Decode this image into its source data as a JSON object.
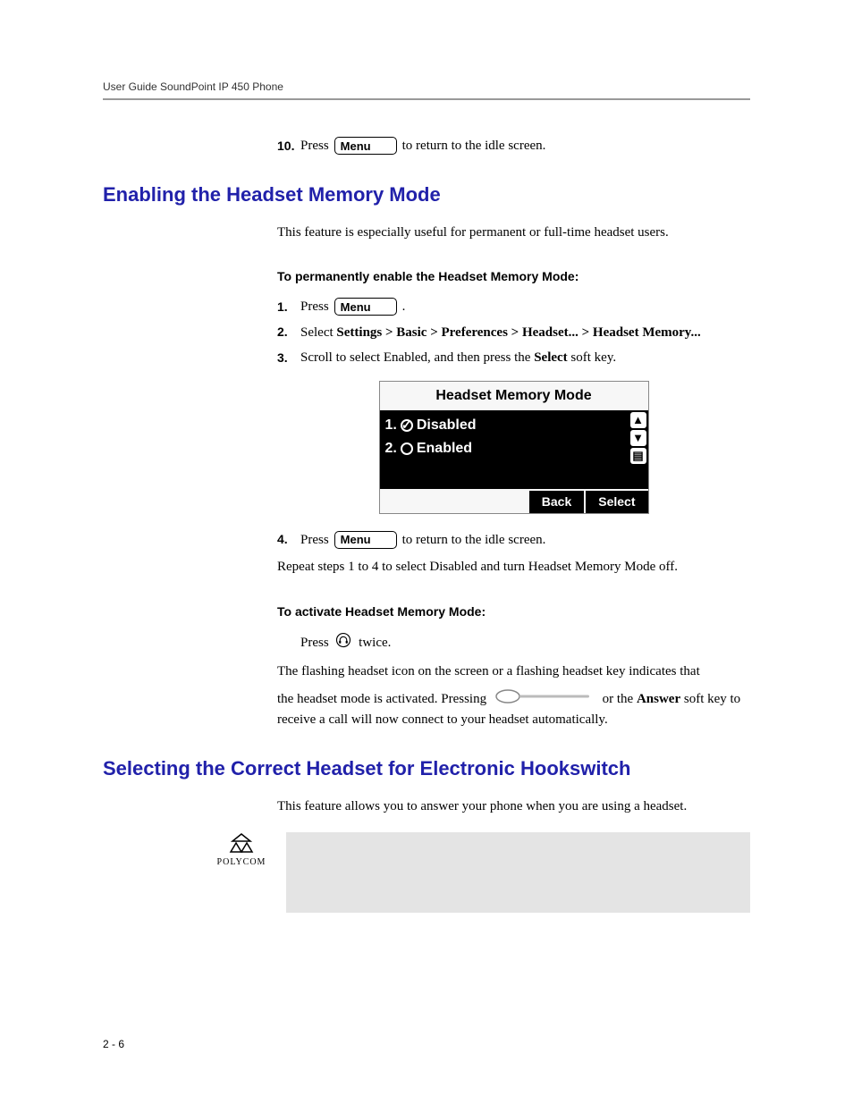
{
  "header": {
    "running": "User Guide SoundPoint IP 450 Phone"
  },
  "step10": {
    "num": "10.",
    "press": "Press",
    "menu": "Menu",
    "after": " to return to the idle screen."
  },
  "sectionA": {
    "heading": "Enabling the Headset Memory Mode",
    "intro": "This feature is especially useful for permanent or full-time headset users.",
    "subhead1": "To permanently enable the Headset Memory Mode:",
    "steps": {
      "s1": {
        "num": "1.",
        "press": "Press",
        "menu": "Menu",
        "after": " ."
      },
      "s2": {
        "num": "2.",
        "prefix": "Select ",
        "bold": "Settings > Basic > Preferences > Headset... > Headset Memory..."
      },
      "s3": {
        "num": "3.",
        "prefix": "Scroll to select Enabled, and then press the ",
        "bold": "Select",
        "suffix": " soft key."
      },
      "s4": {
        "num": "4.",
        "press": "Press",
        "menu": "Menu",
        "after": " to return to the idle screen."
      }
    },
    "screen": {
      "title": "Headset Memory Mode",
      "row1_prefix": "1.",
      "row1_label": "Disabled",
      "row2_prefix": "2.",
      "row2_label": "Enabled",
      "soft_back": "Back",
      "soft_select": "Select"
    },
    "repeatNote": "Repeat steps 1 to 4 to select Disabled and turn Headset Memory Mode off.",
    "subhead2": "To activate Headset Memory Mode:",
    "activate_press": "Press ",
    "activate_twice": " twice.",
    "flash_line": "The flashing headset icon on the screen or a flashing headset key indicates that",
    "mode_line_a": "the headset mode is activated. Pressing ",
    "mode_line_b": " or the ",
    "answer": "Answer",
    "mode_line_c": " soft key to receive a call will now connect to your headset automatically."
  },
  "sectionB": {
    "heading": "Selecting the Correct Headset for Electronic Hookswitch",
    "intro": "This feature allows you to answer your phone when you are using a headset."
  },
  "logo": {
    "brand": "POLYCOM"
  },
  "footer": {
    "pagenum": "2 - 6"
  }
}
